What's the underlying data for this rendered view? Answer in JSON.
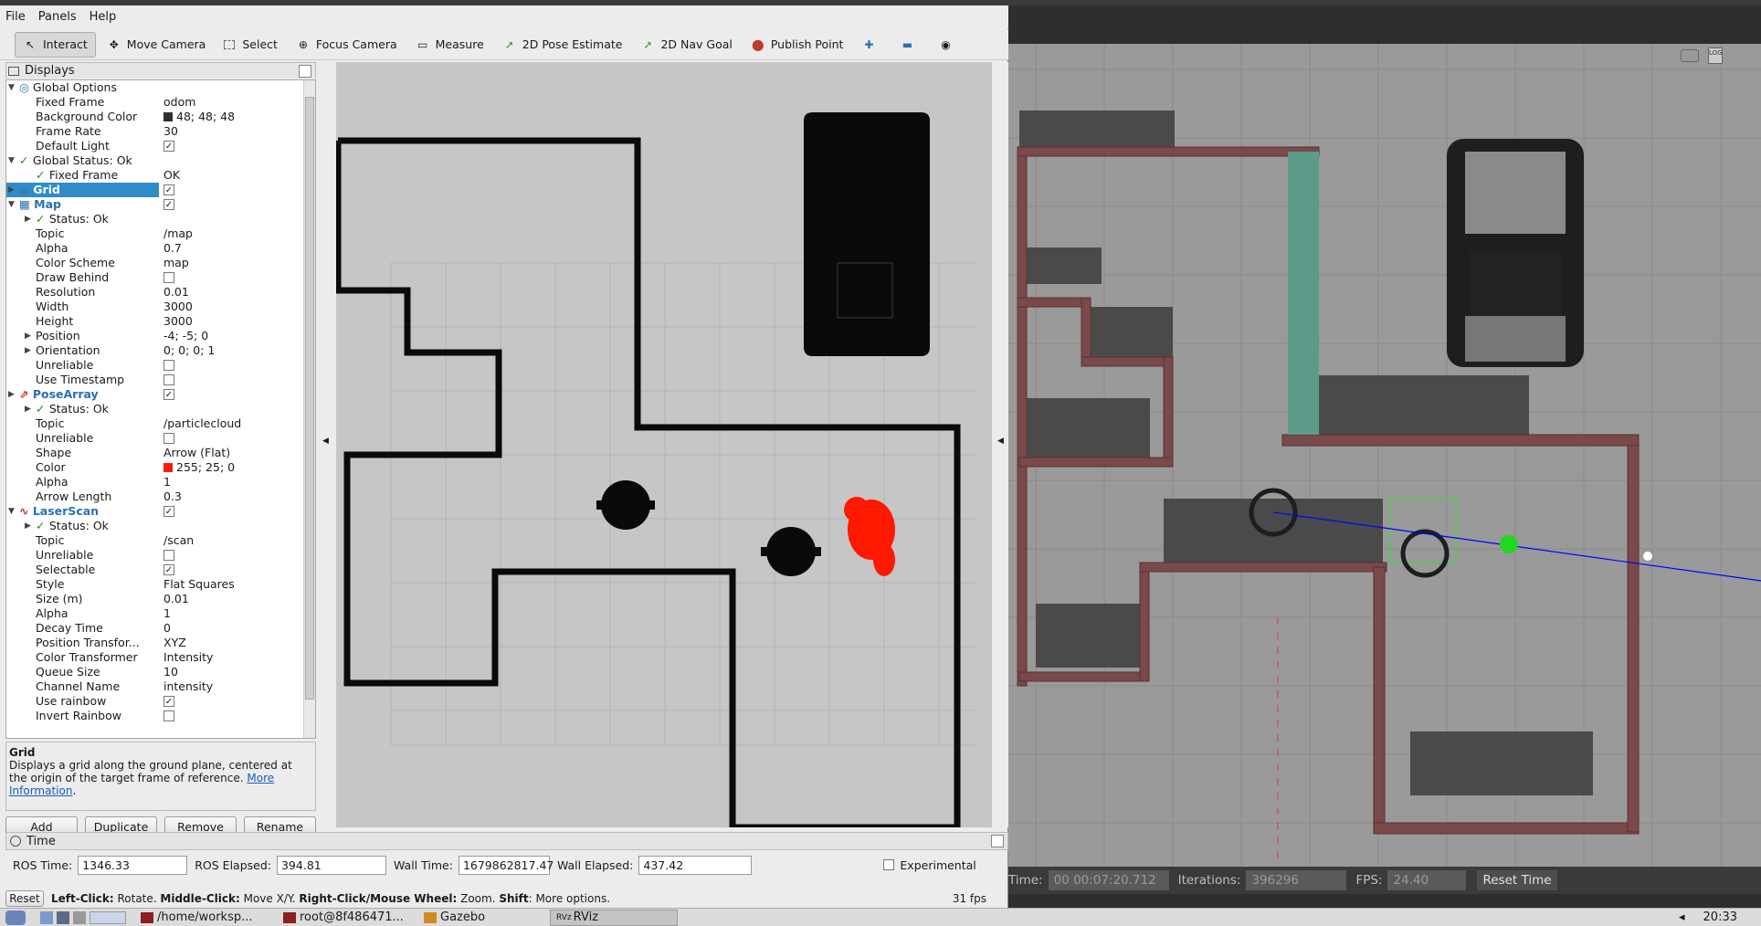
{
  "menu": {
    "file": "File",
    "panels": "Panels",
    "help": "Help"
  },
  "toolbar": {
    "interact": "Interact",
    "move_camera": "Move Camera",
    "select": "Select",
    "focus_camera": "Focus Camera",
    "measure": "Measure",
    "pose_estimate": "2D Pose Estimate",
    "nav_goal": "2D Nav Goal",
    "publish_point": "Publish Point"
  },
  "displays": {
    "title": "Displays",
    "rows": [
      {
        "indent": 0,
        "arrow": "▼",
        "label": "Global Options",
        "value": ""
      },
      {
        "indent": 1,
        "label": "Fixed Frame",
        "value": "odom"
      },
      {
        "indent": 1,
        "label": "Background Color",
        "value": "48; 48; 48",
        "swatch": "#303030"
      },
      {
        "indent": 1,
        "label": "Frame Rate",
        "value": "30"
      },
      {
        "indent": 1,
        "label": "Default Light",
        "check": true
      },
      {
        "indent": 0,
        "arrow": "▼",
        "ok": true,
        "label": "Global Status: Ok",
        "value": ""
      },
      {
        "indent": 1,
        "ok": true,
        "label": "Fixed Frame",
        "value": "OK"
      },
      {
        "indent": 0,
        "arrow": "▶",
        "label": "Grid",
        "check": true,
        "selected": true
      },
      {
        "indent": 0,
        "arrow": "▼",
        "label": "Map",
        "check": true,
        "color": "blue"
      },
      {
        "indent": 1,
        "arrow": "▶",
        "ok": true,
        "label": "Status: Ok",
        "value": ""
      },
      {
        "indent": 1,
        "label": "Topic",
        "value": "/map"
      },
      {
        "indent": 1,
        "label": "Alpha",
        "value": "0.7"
      },
      {
        "indent": 1,
        "label": "Color Scheme",
        "value": "map"
      },
      {
        "indent": 1,
        "label": "Draw Behind",
        "check": false
      },
      {
        "indent": 1,
        "label": "Resolution",
        "value": "0.01"
      },
      {
        "indent": 1,
        "label": "Width",
        "value": "3000"
      },
      {
        "indent": 1,
        "label": "Height",
        "value": "3000"
      },
      {
        "indent": 1,
        "arrow": "▶",
        "label": "Position",
        "value": "-4; -5; 0"
      },
      {
        "indent": 1,
        "arrow": "▶",
        "label": "Orientation",
        "value": "0; 0; 0; 1"
      },
      {
        "indent": 1,
        "label": "Unreliable",
        "check": false
      },
      {
        "indent": 1,
        "label": "Use Timestamp",
        "check": false
      },
      {
        "indent": 0,
        "arrow": "▶",
        "label": "PoseArray",
        "check": true,
        "color": "blue"
      },
      {
        "indent": 1,
        "arrow": "▶",
        "ok": true,
        "label": "Status: Ok",
        "value": ""
      },
      {
        "indent": 1,
        "label": "Topic",
        "value": "/particlecloud"
      },
      {
        "indent": 1,
        "label": "Unreliable",
        "check": false
      },
      {
        "indent": 1,
        "label": "Shape",
        "value": "Arrow (Flat)"
      },
      {
        "indent": 1,
        "label": "Color",
        "value": "255; 25; 0",
        "swatch": "#ff1900"
      },
      {
        "indent": 1,
        "label": "Alpha",
        "value": "1"
      },
      {
        "indent": 1,
        "label": "Arrow Length",
        "value": "0.3"
      },
      {
        "indent": 0,
        "arrow": "▼",
        "label": "LaserScan",
        "check": true,
        "color": "blue"
      },
      {
        "indent": 1,
        "arrow": "▶",
        "ok": true,
        "label": "Status: Ok",
        "value": ""
      },
      {
        "indent": 1,
        "label": "Topic",
        "value": "/scan"
      },
      {
        "indent": 1,
        "label": "Unreliable",
        "check": false
      },
      {
        "indent": 1,
        "label": "Selectable",
        "check": true
      },
      {
        "indent": 1,
        "label": "Style",
        "value": "Flat Squares"
      },
      {
        "indent": 1,
        "label": "Size (m)",
        "value": "0.01"
      },
      {
        "indent": 1,
        "label": "Alpha",
        "value": "1"
      },
      {
        "indent": 1,
        "label": "Decay Time",
        "value": "0"
      },
      {
        "indent": 1,
        "label": "Position Transfor...",
        "value": "XYZ"
      },
      {
        "indent": 1,
        "label": "Color Transformer",
        "value": "Intensity"
      },
      {
        "indent": 1,
        "label": "Queue Size",
        "value": "10"
      },
      {
        "indent": 1,
        "label": "Channel Name",
        "value": "intensity"
      },
      {
        "indent": 1,
        "label": "Use rainbow",
        "check": true
      },
      {
        "indent": 1,
        "label": "Invert Rainbow",
        "check": false
      }
    ]
  },
  "description": {
    "title": "Grid",
    "text": "Displays a grid along the ground plane, centered at the origin of the target frame of reference.",
    "link1": "More",
    "link2": "Information"
  },
  "buttons": {
    "add": "Add",
    "duplicate": "Duplicate",
    "remove": "Remove",
    "rename": "Rename"
  },
  "time": {
    "title": "Time",
    "ros_time_label": "ROS Time:",
    "ros_time": "1346.33",
    "ros_elapsed_label": "ROS Elapsed:",
    "ros_elapsed": "394.81",
    "wall_time_label": "Wall Time:",
    "wall_time": "1679862817.47",
    "wall_elapsed_label": "Wall Elapsed:",
    "wall_elapsed": "437.42",
    "experimental": "Experimental"
  },
  "status": {
    "reset": "Reset",
    "hint_b1": "Left-Click:",
    "hint_t1": " Rotate. ",
    "hint_b2": "Middle-Click:",
    "hint_t2": " Move X/Y. ",
    "hint_b3": "Right-Click/Mouse Wheel:",
    "hint_t3": " Zoom. ",
    "hint_b4": "Shift",
    "hint_t4": ": More options.",
    "fps": "31 fps"
  },
  "gazebo": {
    "time_label": "Time:",
    "time": "00 00:07:20.712",
    "iter_label": "Iterations:",
    "iterations": "396296",
    "fps_label": "FPS:",
    "fps": "24.40",
    "reset_time": "Reset Time",
    "log_badge": "LOG"
  },
  "taskbar": {
    "t1": "/home/worksp...",
    "t2": "root@8f486471...",
    "t3": "Gazebo",
    "t4": "RViz",
    "rviz_badge": "RVz",
    "clock": "20:33"
  },
  "colors": {
    "selection": "#308cc6",
    "particles": "#ff1900",
    "laser": "#0000ff",
    "ok": "#1a8f1a"
  }
}
